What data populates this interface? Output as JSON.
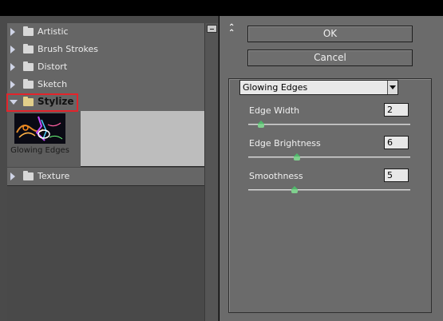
{
  "categories": [
    {
      "label": "Artistic",
      "expanded": false
    },
    {
      "label": "Brush Strokes",
      "expanded": false
    },
    {
      "label": "Distort",
      "expanded": false
    },
    {
      "label": "Sketch",
      "expanded": false
    },
    {
      "label": "Stylize",
      "expanded": true
    },
    {
      "label": "Texture",
      "expanded": false
    }
  ],
  "stylize_filters": [
    {
      "label": "Glowing Edges",
      "selected": true
    }
  ],
  "buttons": {
    "ok": "OK",
    "cancel": "Cancel"
  },
  "filter_select": {
    "value": "Glowing Edges"
  },
  "params": [
    {
      "label": "Edge Width",
      "value": "2",
      "min": 1,
      "max": 14
    },
    {
      "label": "Edge Brightness",
      "value": "6",
      "min": 0,
      "max": 20
    },
    {
      "label": "Smoothness",
      "value": "5",
      "min": 1,
      "max": 15
    }
  ],
  "colors": {
    "highlight": "#e3242b",
    "slider_thumb": "#7fd08e"
  }
}
